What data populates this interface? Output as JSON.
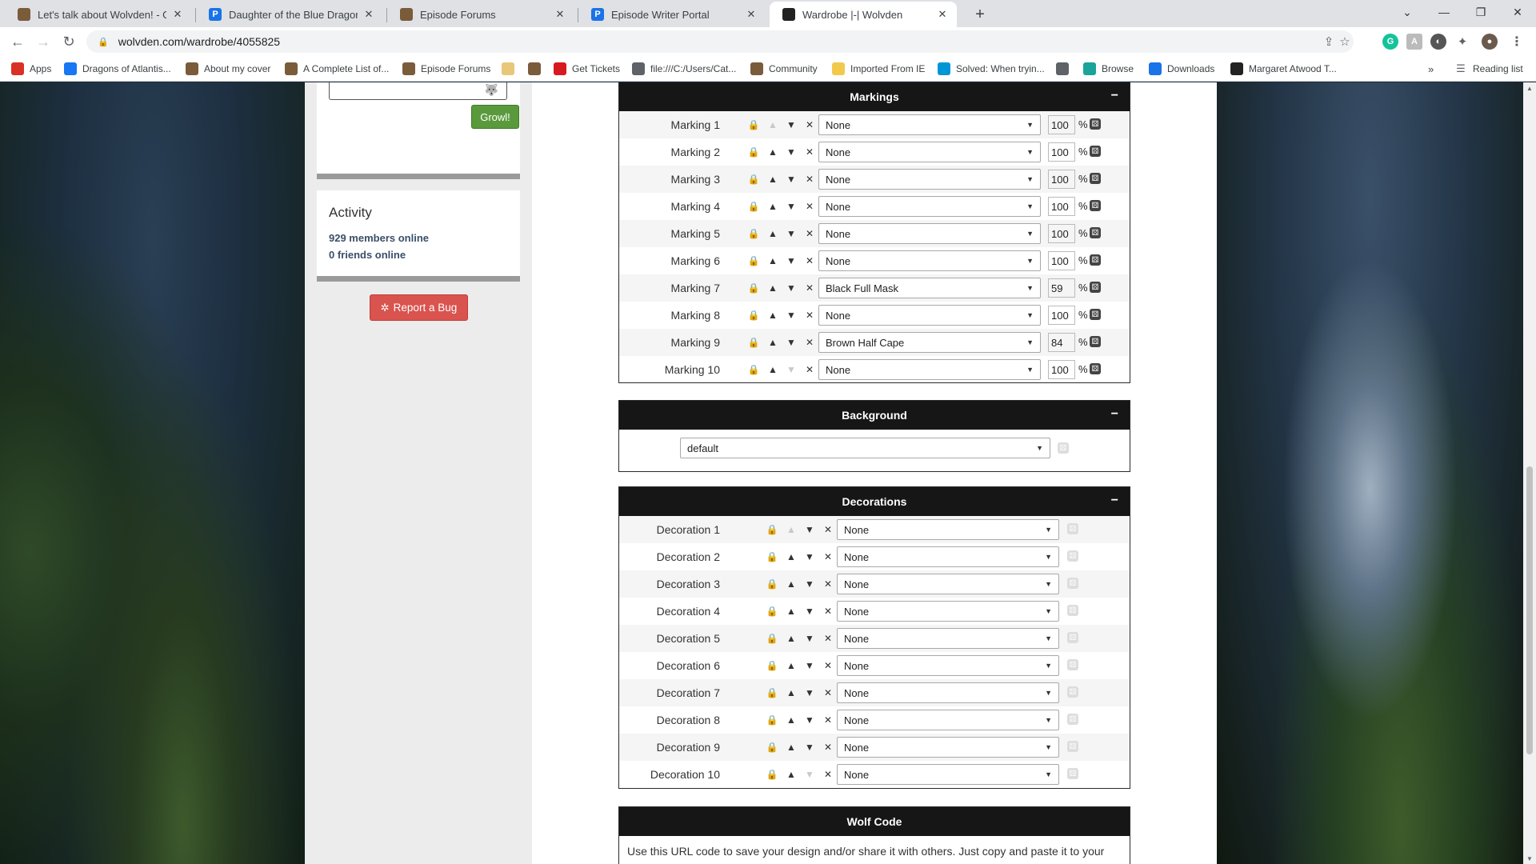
{
  "browser": {
    "tabs": [
      {
        "title": "Let's talk about Wolvden! - Gene",
        "icon": "wolvden-favicon",
        "color": "#7a5b3a"
      },
      {
        "title": "Daughter of the Blue Dragon",
        "icon": "p-favicon",
        "color": "#1a73e8"
      },
      {
        "title": "Episode Forums",
        "icon": "wolvden-favicon",
        "color": "#7a5b3a"
      },
      {
        "title": "Episode Writer Portal",
        "icon": "p-favicon",
        "color": "#1a73e8"
      },
      {
        "title": "Wardrobe |-| Wolvden",
        "icon": "wolf-favicon",
        "color": "#222222"
      }
    ],
    "url": "wolvden.com/wardrobe/4055825",
    "bookmarks": [
      {
        "label": "Apps",
        "icon": "apps-grid-icon",
        "color": "#d93025"
      },
      {
        "label": "Dragons of Atlantis...",
        "icon": "facebook-icon",
        "color": "#1877f2"
      },
      {
        "label": "About my cover",
        "icon": "wolvden-icon",
        "color": "#7a5b3a"
      },
      {
        "label": "A Complete List of...",
        "icon": "wolvden-icon",
        "color": "#7a5b3a"
      },
      {
        "label": "Episode Forums",
        "icon": "wolvden-icon",
        "color": "#7a5b3a"
      },
      {
        "label": "",
        "icon": "doc-icon",
        "color": "#e8c77a"
      },
      {
        "label": "",
        "icon": "wolvden-icon",
        "color": "#7a5b3a"
      },
      {
        "label": "Get Tickets",
        "icon": "amc-icon",
        "color": "#d71920"
      },
      {
        "label": "file:///C:/Users/Cat...",
        "icon": "globe-icon",
        "color": "#5f6368"
      },
      {
        "label": "Community",
        "icon": "wolvden-icon",
        "color": "#7a5b3a"
      },
      {
        "label": "Imported From IE",
        "icon": "folder-icon",
        "color": "#f2c94c"
      },
      {
        "label": "Solved: When tryin...",
        "icon": "hp-icon",
        "color": "#0096d6"
      },
      {
        "label": "",
        "icon": "globe-icon",
        "color": "#5f6368"
      },
      {
        "label": "Browse",
        "icon": "d-icon",
        "color": "#1aa39a"
      },
      {
        "label": "Downloads",
        "icon": "download-icon",
        "color": "#1a73e8"
      },
      {
        "label": "Margaret Atwood T...",
        "icon": "ma-icon",
        "color": "#222222"
      }
    ],
    "reading_list": "Reading list"
  },
  "sidebar": {
    "growl_button": "Growl!",
    "activity_title": "Activity",
    "members_online": "929 members online",
    "friends_online": "0 friends online",
    "report_bug": "Report a Bug"
  },
  "markings": {
    "title": "Markings",
    "collapse": "−",
    "rows": [
      {
        "label": "Marking 1",
        "value": "None",
        "percent": "100",
        "up_disabled": true,
        "down_disabled": false
      },
      {
        "label": "Marking 2",
        "value": "None",
        "percent": "100",
        "up_disabled": false,
        "down_disabled": false
      },
      {
        "label": "Marking 3",
        "value": "None",
        "percent": "100",
        "up_disabled": false,
        "down_disabled": false
      },
      {
        "label": "Marking 4",
        "value": "None",
        "percent": "100",
        "up_disabled": false,
        "down_disabled": false
      },
      {
        "label": "Marking 5",
        "value": "None",
        "percent": "100",
        "up_disabled": false,
        "down_disabled": false
      },
      {
        "label": "Marking 6",
        "value": "None",
        "percent": "100",
        "up_disabled": false,
        "down_disabled": false
      },
      {
        "label": "Marking 7",
        "value": "Black Full Mask",
        "percent": "59",
        "up_disabled": false,
        "down_disabled": false
      },
      {
        "label": "Marking 8",
        "value": "None",
        "percent": "100",
        "up_disabled": false,
        "down_disabled": false
      },
      {
        "label": "Marking 9",
        "value": "Brown Half Cape",
        "percent": "84",
        "up_disabled": false,
        "down_disabled": false
      },
      {
        "label": "Marking 10",
        "value": "None",
        "percent": "100",
        "up_disabled": false,
        "down_disabled": true
      }
    ],
    "percent_sign": "%"
  },
  "background": {
    "title": "Background",
    "collapse": "−",
    "value": "default"
  },
  "decorations": {
    "title": "Decorations",
    "collapse": "−",
    "rows": [
      {
        "label": "Decoration 1",
        "value": "None",
        "up_disabled": true,
        "down_disabled": false
      },
      {
        "label": "Decoration 2",
        "value": "None",
        "up_disabled": false,
        "down_disabled": false
      },
      {
        "label": "Decoration 3",
        "value": "None",
        "up_disabled": false,
        "down_disabled": false
      },
      {
        "label": "Decoration 4",
        "value": "None",
        "up_disabled": false,
        "down_disabled": false
      },
      {
        "label": "Decoration 5",
        "value": "None",
        "up_disabled": false,
        "down_disabled": false
      },
      {
        "label": "Decoration 6",
        "value": "None",
        "up_disabled": false,
        "down_disabled": false
      },
      {
        "label": "Decoration 7",
        "value": "None",
        "up_disabled": false,
        "down_disabled": false
      },
      {
        "label": "Decoration 8",
        "value": "None",
        "up_disabled": false,
        "down_disabled": false
      },
      {
        "label": "Decoration 9",
        "value": "None",
        "up_disabled": false,
        "down_disabled": false
      },
      {
        "label": "Decoration 10",
        "value": "None",
        "up_disabled": false,
        "down_disabled": true
      }
    ]
  },
  "wolf_code": {
    "title": "Wolf Code",
    "text": "Use this URL code to save your design and/or share it with others. Just copy and paste it to your"
  }
}
